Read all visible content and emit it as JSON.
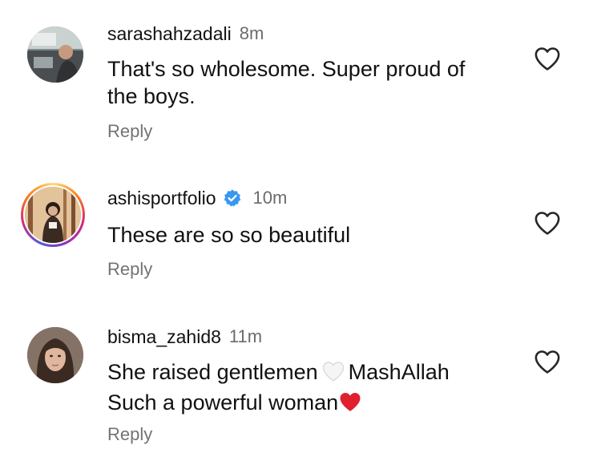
{
  "comments": [
    {
      "username": "sarashahzadali",
      "time": "8m",
      "text_line1": "That's so wholesome. Super proud of",
      "text_line2": "the boys.",
      "reply_label": "Reply"
    },
    {
      "username": "ashisportfolio",
      "verified": true,
      "time": "10m",
      "text_line1": "These are so so beautiful",
      "reply_label": "Reply"
    },
    {
      "username": "bisma_zahid8",
      "time": "11m",
      "text_line1_a": "She raised gentlemen",
      "text_line1_b": "MashAllah",
      "text_line2": "Such a powerful woman",
      "reply_label": "Reply"
    }
  ],
  "icons": {
    "like": "heart-outline-icon",
    "verified": "verified-badge-icon",
    "white_heart": "white-heart-emoji",
    "red_heart": "red-heart-emoji"
  },
  "colors": {
    "verified_blue": "#3897f0",
    "red_heart": "#e0202f",
    "meta_gray": "#737373"
  }
}
